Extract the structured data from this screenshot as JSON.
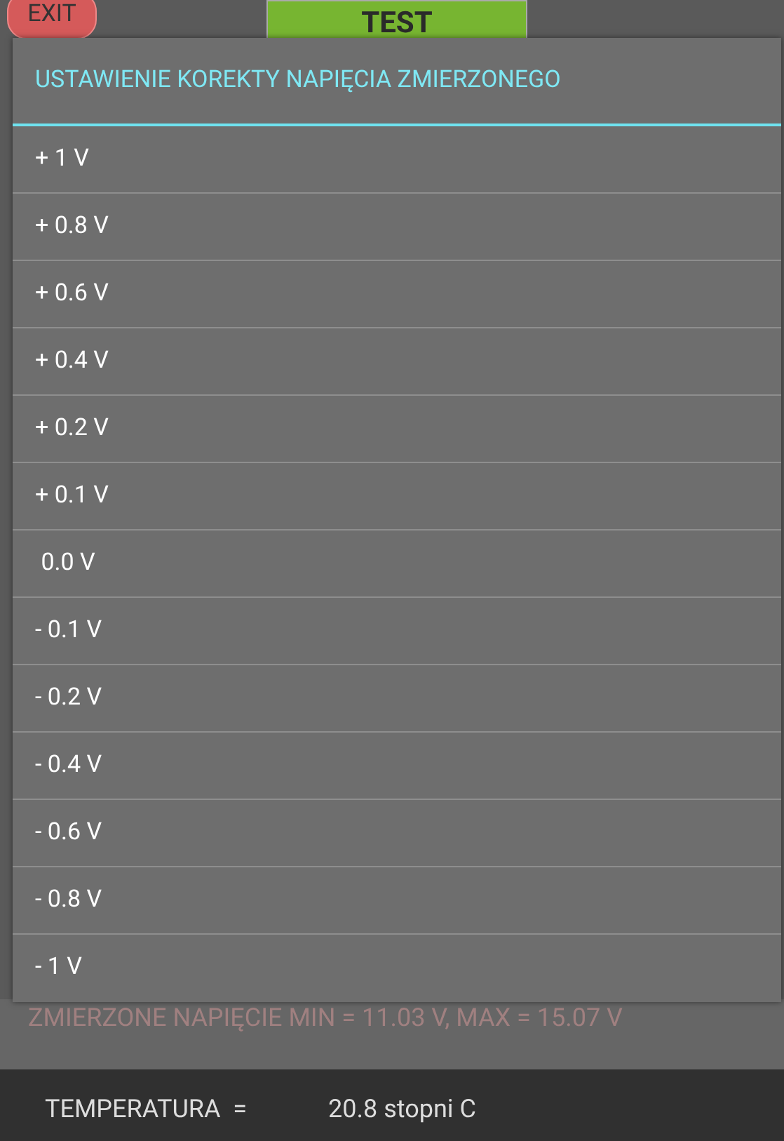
{
  "top_bar": {
    "exit_button": "EXIT",
    "test_button": "TEST"
  },
  "dialog": {
    "title": "USTAWIENIE KOREKTY NAPIĘCIA ZMIERZONEGO",
    "options": [
      "+ 1 V",
      "+ 0.8 V",
      "+ 0.6 V",
      "+ 0.4 V",
      "+ 0.2 V",
      "+ 0.1 V",
      " 0.0 V",
      "- 0.1 V",
      "- 0.2 V",
      "- 0.4 V",
      "- 0.6 V",
      "- 0.8 V",
      "- 1 V"
    ]
  },
  "voltage_range": "ZMIERZONE NAPIĘCIE MIN = 11.03 V, MAX = 15.07 V",
  "temperature": {
    "label": "TEMPERATURA  =",
    "value": "20.8 stopni C"
  }
}
